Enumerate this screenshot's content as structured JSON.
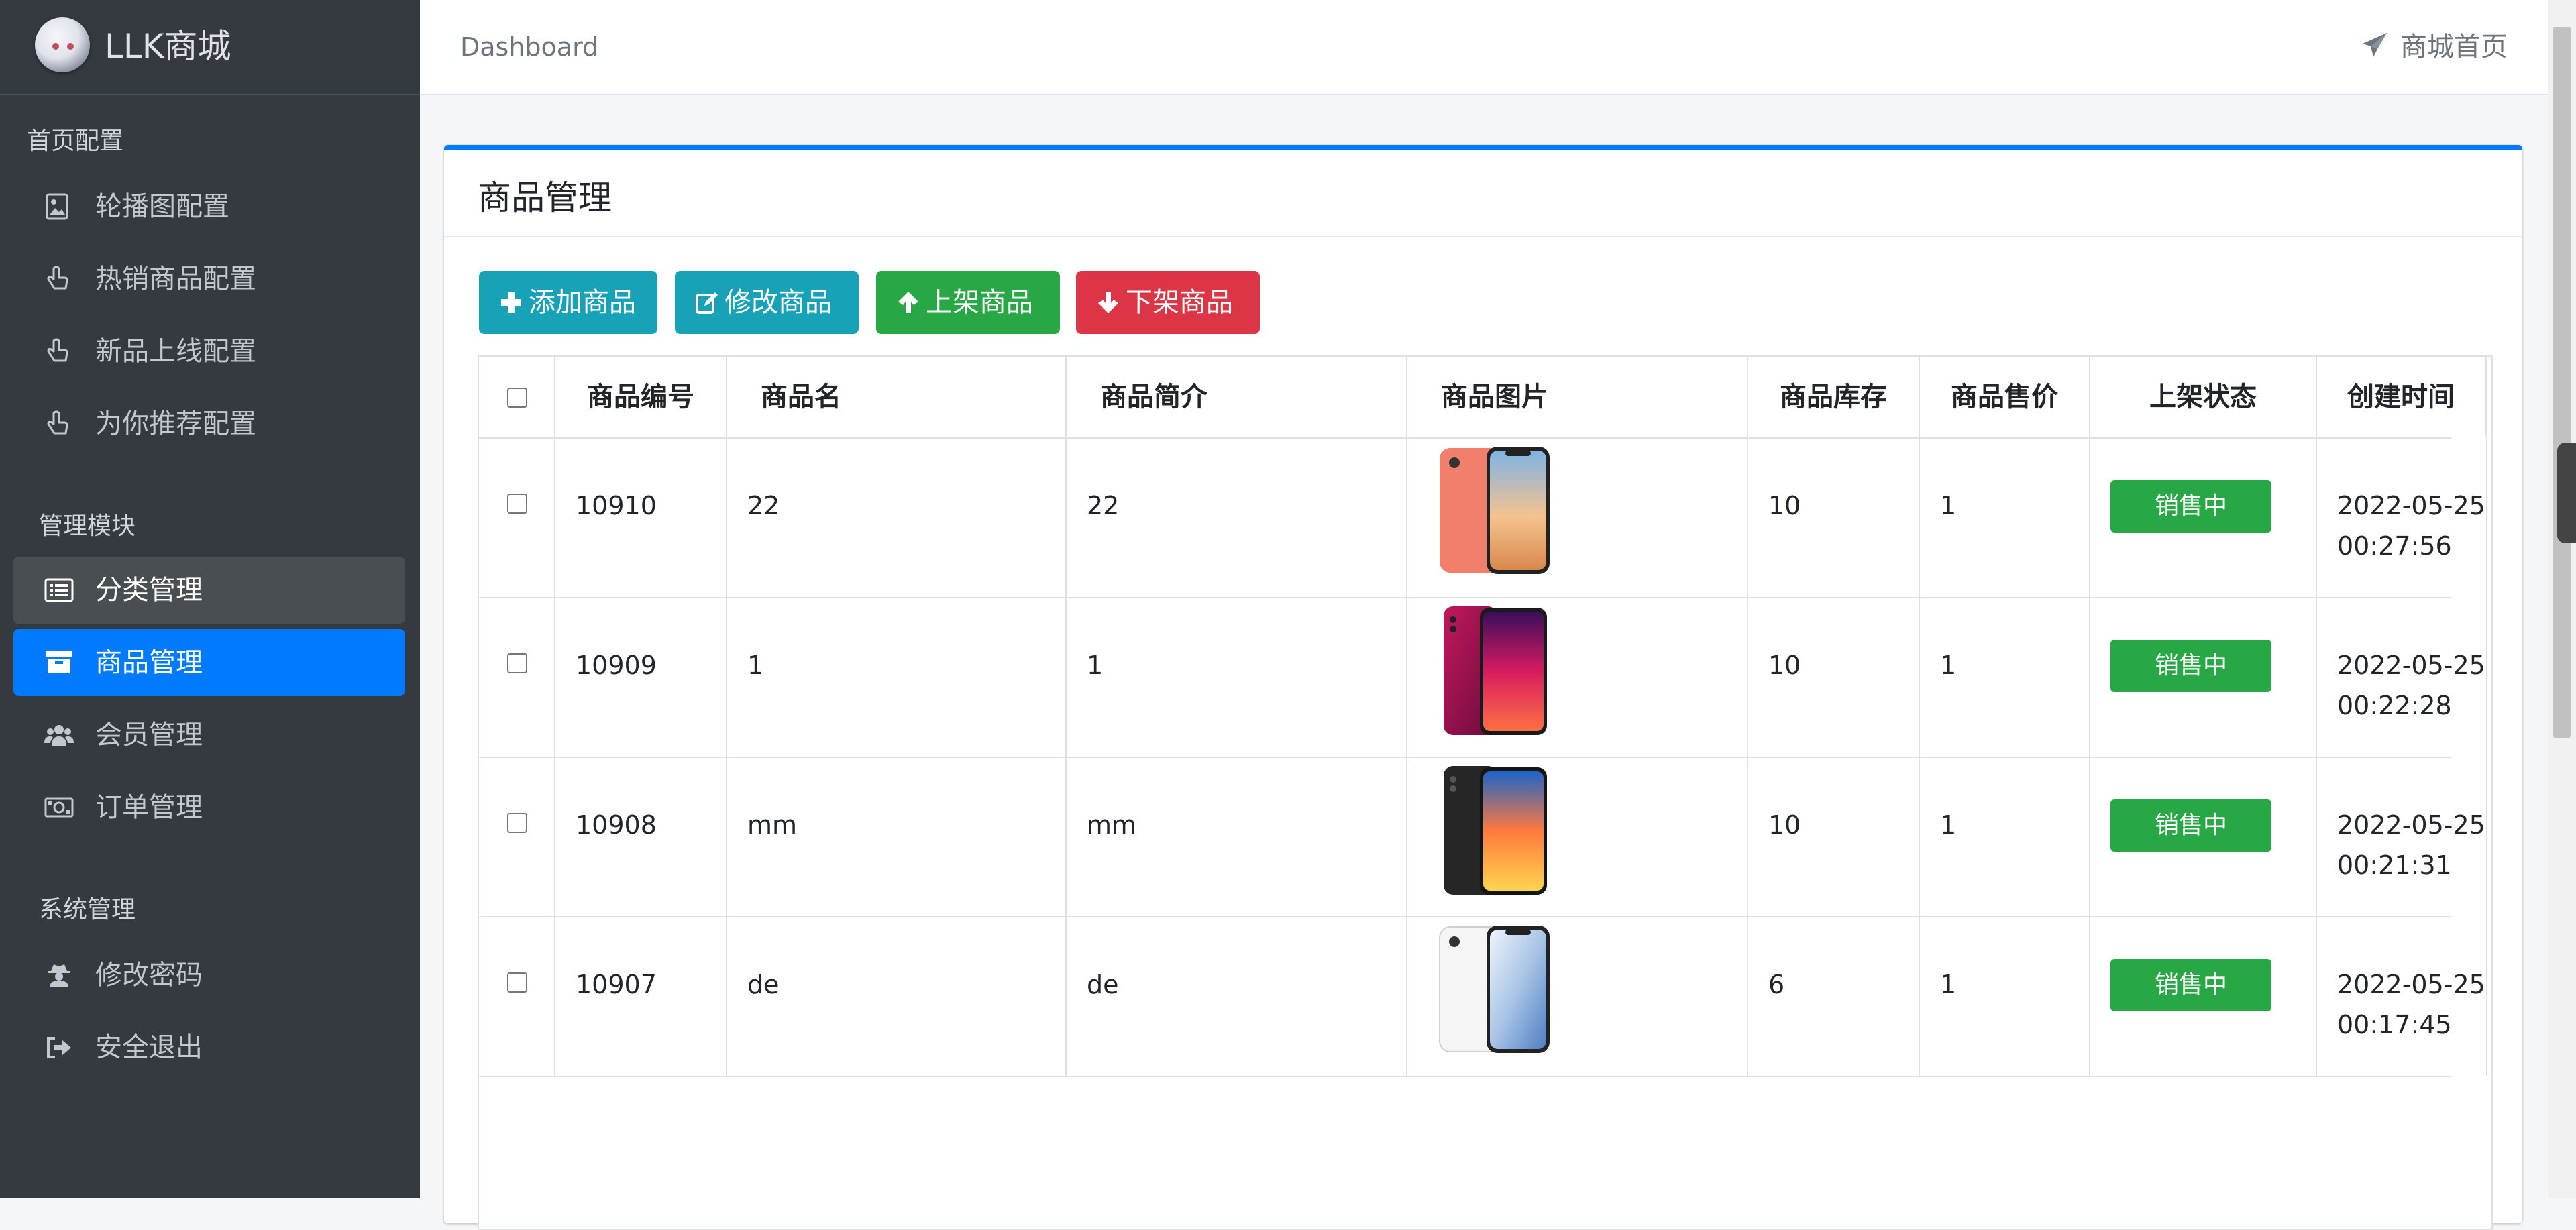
{
  "brand": {
    "name": "LLK商城"
  },
  "sidebar": {
    "sections": [
      {
        "header": "首页配置",
        "items": [
          {
            "label": "轮播图配置",
            "icon": "image-icon"
          },
          {
            "label": "热销商品配置",
            "icon": "hand-pointer-icon"
          },
          {
            "label": "新品上线配置",
            "icon": "hand-pointer-icon"
          },
          {
            "label": "为你推荐配置",
            "icon": "hand-pointer-icon"
          }
        ]
      },
      {
        "header": "管理模块",
        "items": [
          {
            "label": "分类管理",
            "icon": "list-icon",
            "state": "hover"
          },
          {
            "label": "商品管理",
            "icon": "archive-icon",
            "state": "active"
          },
          {
            "label": "会员管理",
            "icon": "users-icon"
          },
          {
            "label": "订单管理",
            "icon": "money-bill-icon"
          }
        ]
      },
      {
        "header": "系统管理",
        "items": [
          {
            "label": "修改密码",
            "icon": "user-secret-icon"
          },
          {
            "label": "安全退出",
            "icon": "sign-out-icon"
          }
        ]
      }
    ]
  },
  "topbar": {
    "breadcrumb": "Dashboard",
    "home_link": "商城首页"
  },
  "card": {
    "title": "商品管理",
    "buttons": {
      "add": "添加商品",
      "edit": "修改商品",
      "up": "上架商品",
      "down": "下架商品"
    }
  },
  "table": {
    "headers": [
      "商品编号",
      "商品名",
      "商品简介",
      "商品图片",
      "商品库存",
      "商品售价",
      "上架状态",
      "创建时间"
    ],
    "rows": [
      {
        "id": "10910",
        "name": "22",
        "intro": "22",
        "image": "coral-phone",
        "stock": "10",
        "price": "1",
        "status": "销售中",
        "date": "2022-05-25",
        "time": "00:27:56"
      },
      {
        "id": "10909",
        "name": "1",
        "intro": "1",
        "image": "magenta-phone",
        "stock": "10",
        "price": "1",
        "status": "销售中",
        "date": "2022-05-25",
        "time": "00:22:28"
      },
      {
        "id": "10908",
        "name": "mm",
        "intro": "mm",
        "image": "black-phone",
        "stock": "10",
        "price": "1",
        "status": "销售中",
        "date": "2022-05-25",
        "time": "00:21:31"
      },
      {
        "id": "10907",
        "name": "de",
        "intro": "de",
        "image": "white-phone",
        "stock": "6",
        "price": "1",
        "status": "销售中",
        "date": "2022-05-25",
        "time": "00:17:45"
      }
    ]
  },
  "colors": {
    "sidebar_bg": "#343a40",
    "active": "#007bff",
    "info": "#17a2b8",
    "success": "#28a745",
    "danger": "#dc3545"
  }
}
